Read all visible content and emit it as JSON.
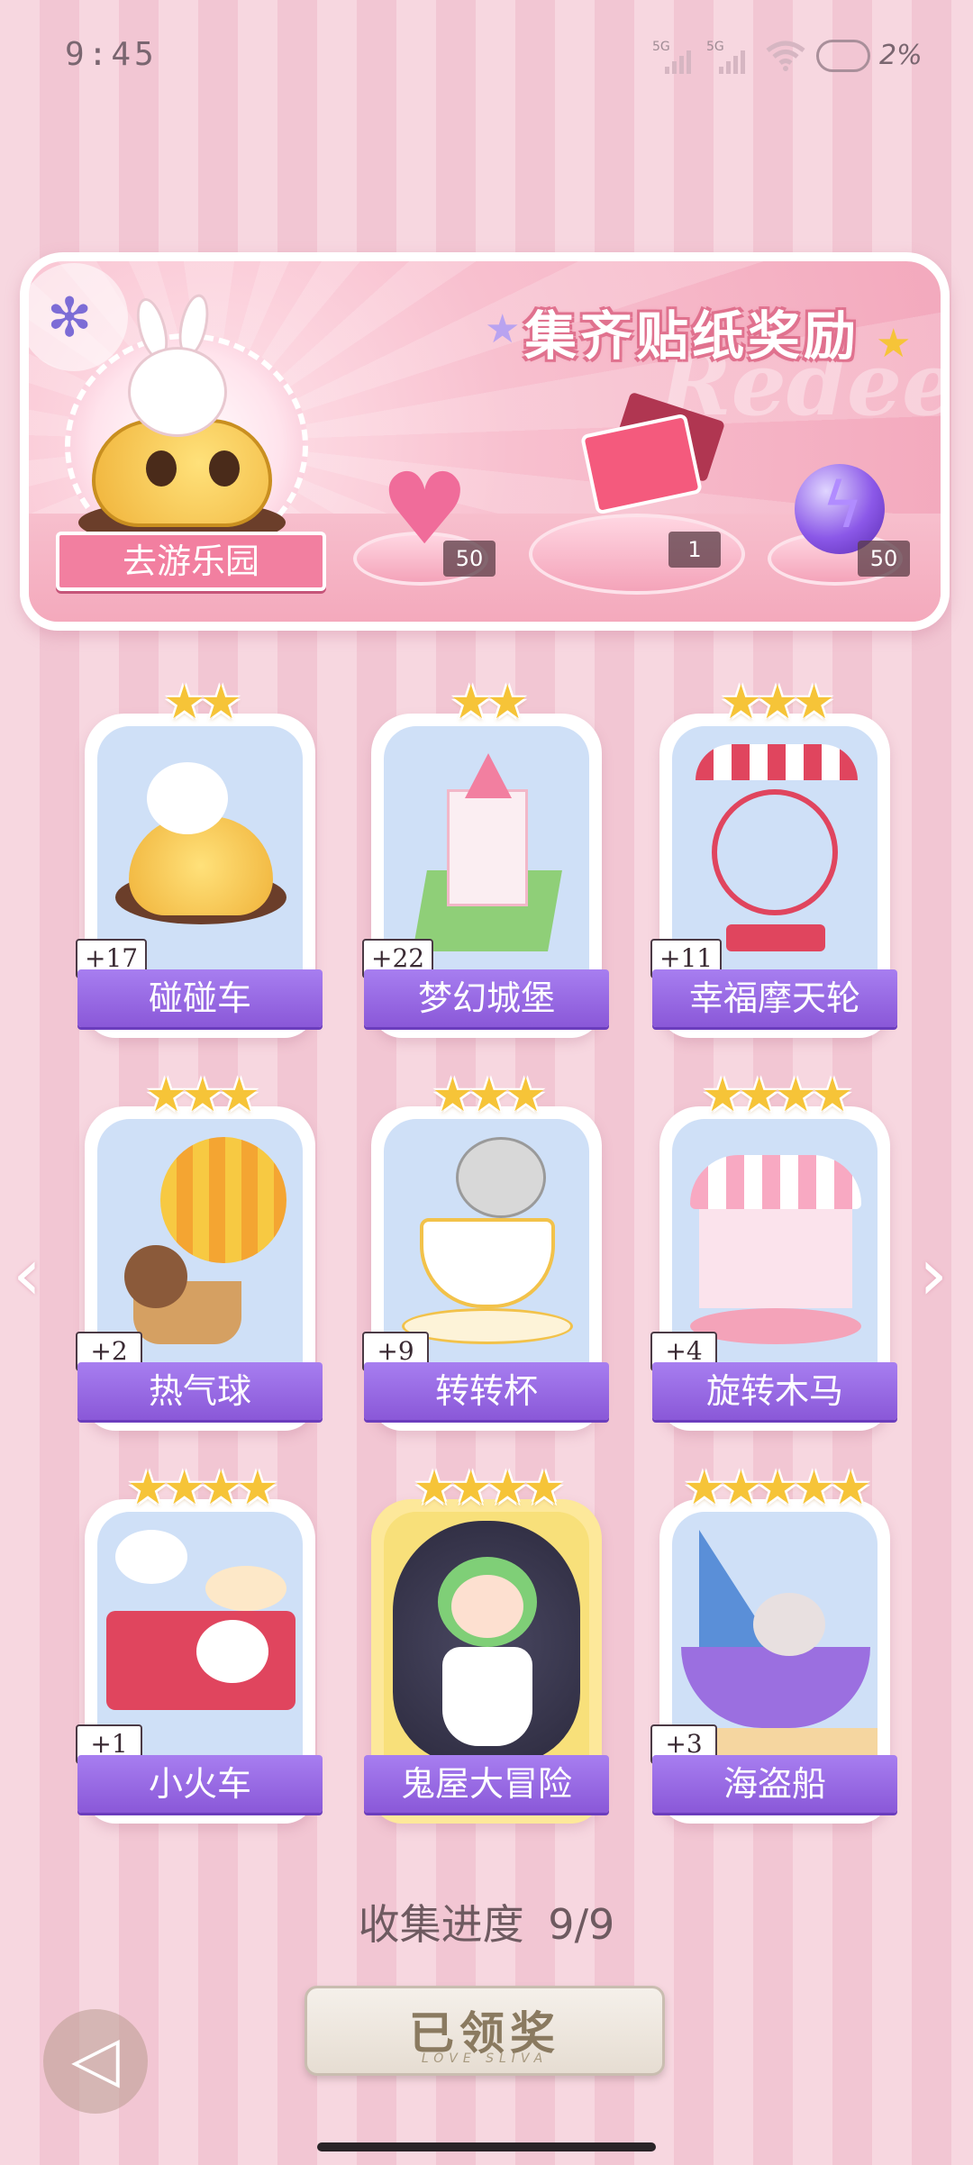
{
  "status_bar": {
    "time": "9:45",
    "sim1_net": "5G",
    "sim2_net": "5G",
    "battery": "2%"
  },
  "banner": {
    "title": "集齐贴纸奖励",
    "watermark": "Redeem",
    "go_button": "去游乐园",
    "rewards": [
      {
        "icon": "pink-heart-gem-icon",
        "count": "50"
      },
      {
        "icon": "gift-box-icon",
        "count": "1"
      },
      {
        "icon": "lightning-orb-icon",
        "count": "50"
      }
    ]
  },
  "cards": [
    {
      "name": "碰碰车",
      "count": "+17",
      "stars": "★★"
    },
    {
      "name": "梦幻城堡",
      "count": "+22",
      "stars": "★★"
    },
    {
      "name": "幸福摩天轮",
      "count": "+11",
      "stars": "★★★"
    },
    {
      "name": "热气球",
      "count": "+2",
      "stars": "★★★"
    },
    {
      "name": "转转杯",
      "count": "+9",
      "stars": "★★★"
    },
    {
      "name": "旋转木马",
      "count": "+4",
      "stars": "★★★★"
    },
    {
      "name": "小火车",
      "count": "+1",
      "stars": "★★★★"
    },
    {
      "name": "鬼屋大冒险",
      "count": "",
      "stars": "★★★★"
    },
    {
      "name": "海盗船",
      "count": "+3",
      "stars": "★★★★★"
    }
  ],
  "progress": {
    "label": "收集进度",
    "value": "9/9"
  },
  "claim_button": {
    "label": "已领奖",
    "sub": "LOVE SLIVA"
  },
  "nav": {
    "prev": "‹",
    "next": "›",
    "back": "◁"
  },
  "colors": {
    "accent_pink": "#f27fa0",
    "label_purple": "#8a58d8",
    "star_gold": "#f6c438"
  }
}
